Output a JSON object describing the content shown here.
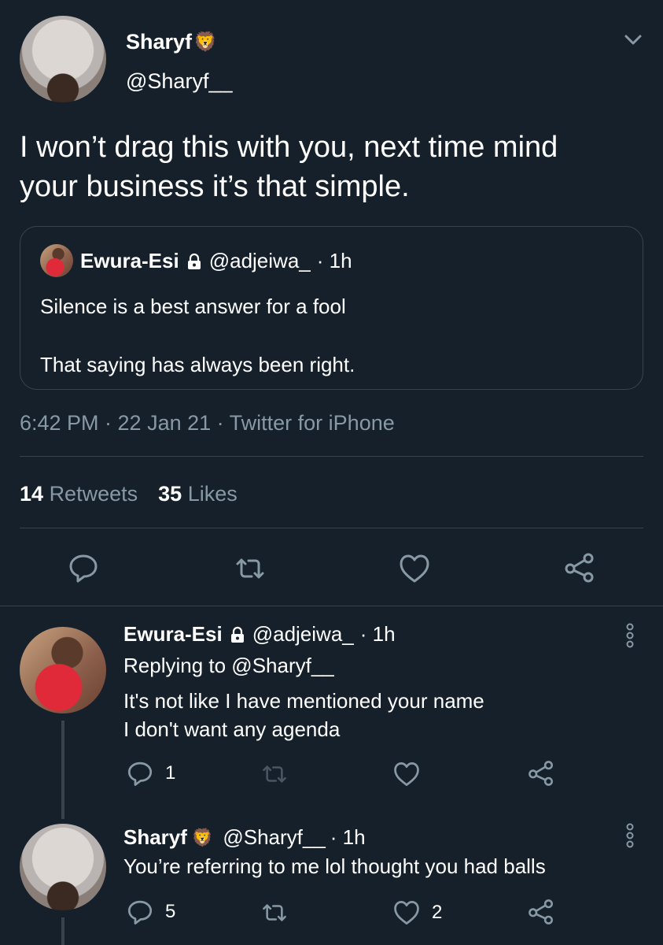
{
  "main_tweet": {
    "author_name": "Sharyf",
    "author_emoji": "🦁",
    "author_handle": "@Sharyf__",
    "text_line1": "I won’t drag this with you, next time mind",
    "text_line2": "your business it’s that simple.",
    "quoted": {
      "author_name": "Ewura-Esi",
      "author_handle": "@adjeiwa_",
      "time": "· 1h",
      "line1": "Silence is a best answer for a fool",
      "line2": "That saying has always been right."
    },
    "meta": "6:42 PM · 22 Jan 21 · Twitter for iPhone",
    "retweets_count": "14",
    "retweets_label": "Retweets",
    "likes_count": "35",
    "likes_label": "Likes"
  },
  "replies": [
    {
      "author_name": "Ewura-Esi",
      "author_handle": "@adjeiwa_",
      "time": "· 1h",
      "replying_to": "Replying to @Sharyf__",
      "line1": "It's not like I have mentioned your name",
      "line2": "I don't want any agenda",
      "reply_count": "1",
      "like_count": ""
    },
    {
      "author_name": "Sharyf",
      "author_emoji": "🦁",
      "author_handle": "@Sharyf__",
      "time": "· 1h",
      "line1": "You’re referring to me lol thought you had balls",
      "reply_count": "5",
      "like_count": "2"
    }
  ],
  "colors": {
    "background": "#15202b",
    "muted": "#8899a6",
    "divider": "#38444d",
    "text": "#ffffff"
  }
}
